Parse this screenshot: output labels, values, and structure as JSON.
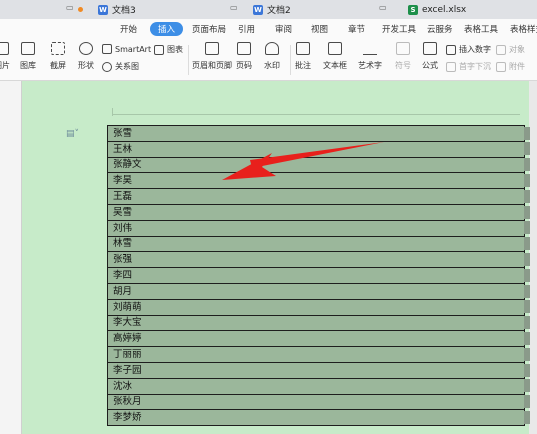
{
  "tabs": [
    {
      "label": "文档3",
      "icon_color": "#3b76d8",
      "icon_letter": "W",
      "active": false
    },
    {
      "label": "文档2",
      "icon_color": "#3b76d8",
      "icon_letter": "W",
      "active": false
    },
    {
      "label": "excel.xlsx",
      "icon_color": "#1d8f4a",
      "icon_letter": "S",
      "active": false
    }
  ],
  "menu": [
    "开始",
    "插入",
    "页面布局",
    "引用",
    "审阅",
    "视图",
    "章节",
    "开发工具",
    "云服务",
    "表格工具",
    "表格样式"
  ],
  "toolbar": {
    "picture": "图片",
    "gallery": "图库",
    "screenshot": "截屏",
    "shape": "形状",
    "smartart": "SmartArt",
    "chart": "图表",
    "relation": "关系图",
    "header_footer": "页眉和页脚",
    "page_number": "页码",
    "watermark": "水印",
    "comment": "批注",
    "textbox": "文本框",
    "wordart": "艺术字",
    "symbol": "符号",
    "formula": "公式",
    "insert_number": "插入数字",
    "object": "对象",
    "first_drop": "首字下沉",
    "attachment": "附件"
  },
  "names": [
    "张雪",
    "王林",
    "张静文",
    "李昊",
    "王磊",
    "吴雪",
    "刘伟",
    "林雪",
    "张强",
    "李四",
    "胡月",
    "刘萌萌",
    "李大宝",
    "高婷婷",
    "丁丽丽",
    "李子园",
    "沈冰",
    "张秋月",
    "李梦娇"
  ],
  "colors": {
    "page_bg": "#c7ebc9",
    "cell_fill": "#9bb79b",
    "arrow": "#e8201c",
    "active_tab": "#3d8ee6"
  }
}
